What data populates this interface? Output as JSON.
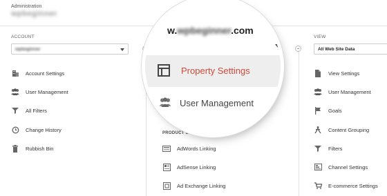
{
  "header": {
    "admin_label": "Administration",
    "account_name": "wpbeginner"
  },
  "account": {
    "label": "ACCOUNT",
    "select_value": "wpbeginner",
    "items": [
      {
        "label": "Account Settings",
        "icon": "building-icon"
      },
      {
        "label": "User Management",
        "icon": "people-icon"
      },
      {
        "label": "All Filters",
        "icon": "filter-icon"
      },
      {
        "label": "Change History",
        "icon": "history-icon"
      },
      {
        "label": "Rubbish Bin",
        "icon": "trash-icon"
      }
    ]
  },
  "property": {
    "url_prefix": "w.",
    "url_blur": "wpbeginner",
    "url_suffix": ".com",
    "items_magnified": [
      {
        "label": "Property Settings",
        "icon": "property-icon",
        "active": true
      },
      {
        "label": "User Management",
        "icon": "people-icon"
      }
    ],
    "product_linking_label": "PRODUCT LI",
    "product_items": [
      {
        "label": "AdWords Linking",
        "icon": "adwords-icon"
      },
      {
        "label": "AdSense Linking",
        "icon": "adsense-icon"
      },
      {
        "label": "Ad Exchange Linking",
        "icon": "adexchange-icon"
      }
    ]
  },
  "view": {
    "label": "VIEW",
    "select_value": "All Web Site Data",
    "items": [
      {
        "label": "View Settings",
        "icon": "document-icon"
      },
      {
        "label": "User Management",
        "icon": "people-icon"
      },
      {
        "label": "Goals",
        "icon": "flag-icon"
      },
      {
        "label": "Content Grouping",
        "icon": "walker-icon"
      },
      {
        "label": "Filters",
        "icon": "filter-icon"
      },
      {
        "label": "Channel Settings",
        "icon": "channel-icon"
      },
      {
        "label": "E-commerce Settings",
        "icon": "cart-icon"
      }
    ]
  },
  "colors": {
    "active": "#d04a3a",
    "divider": "#e2e2e2"
  }
}
